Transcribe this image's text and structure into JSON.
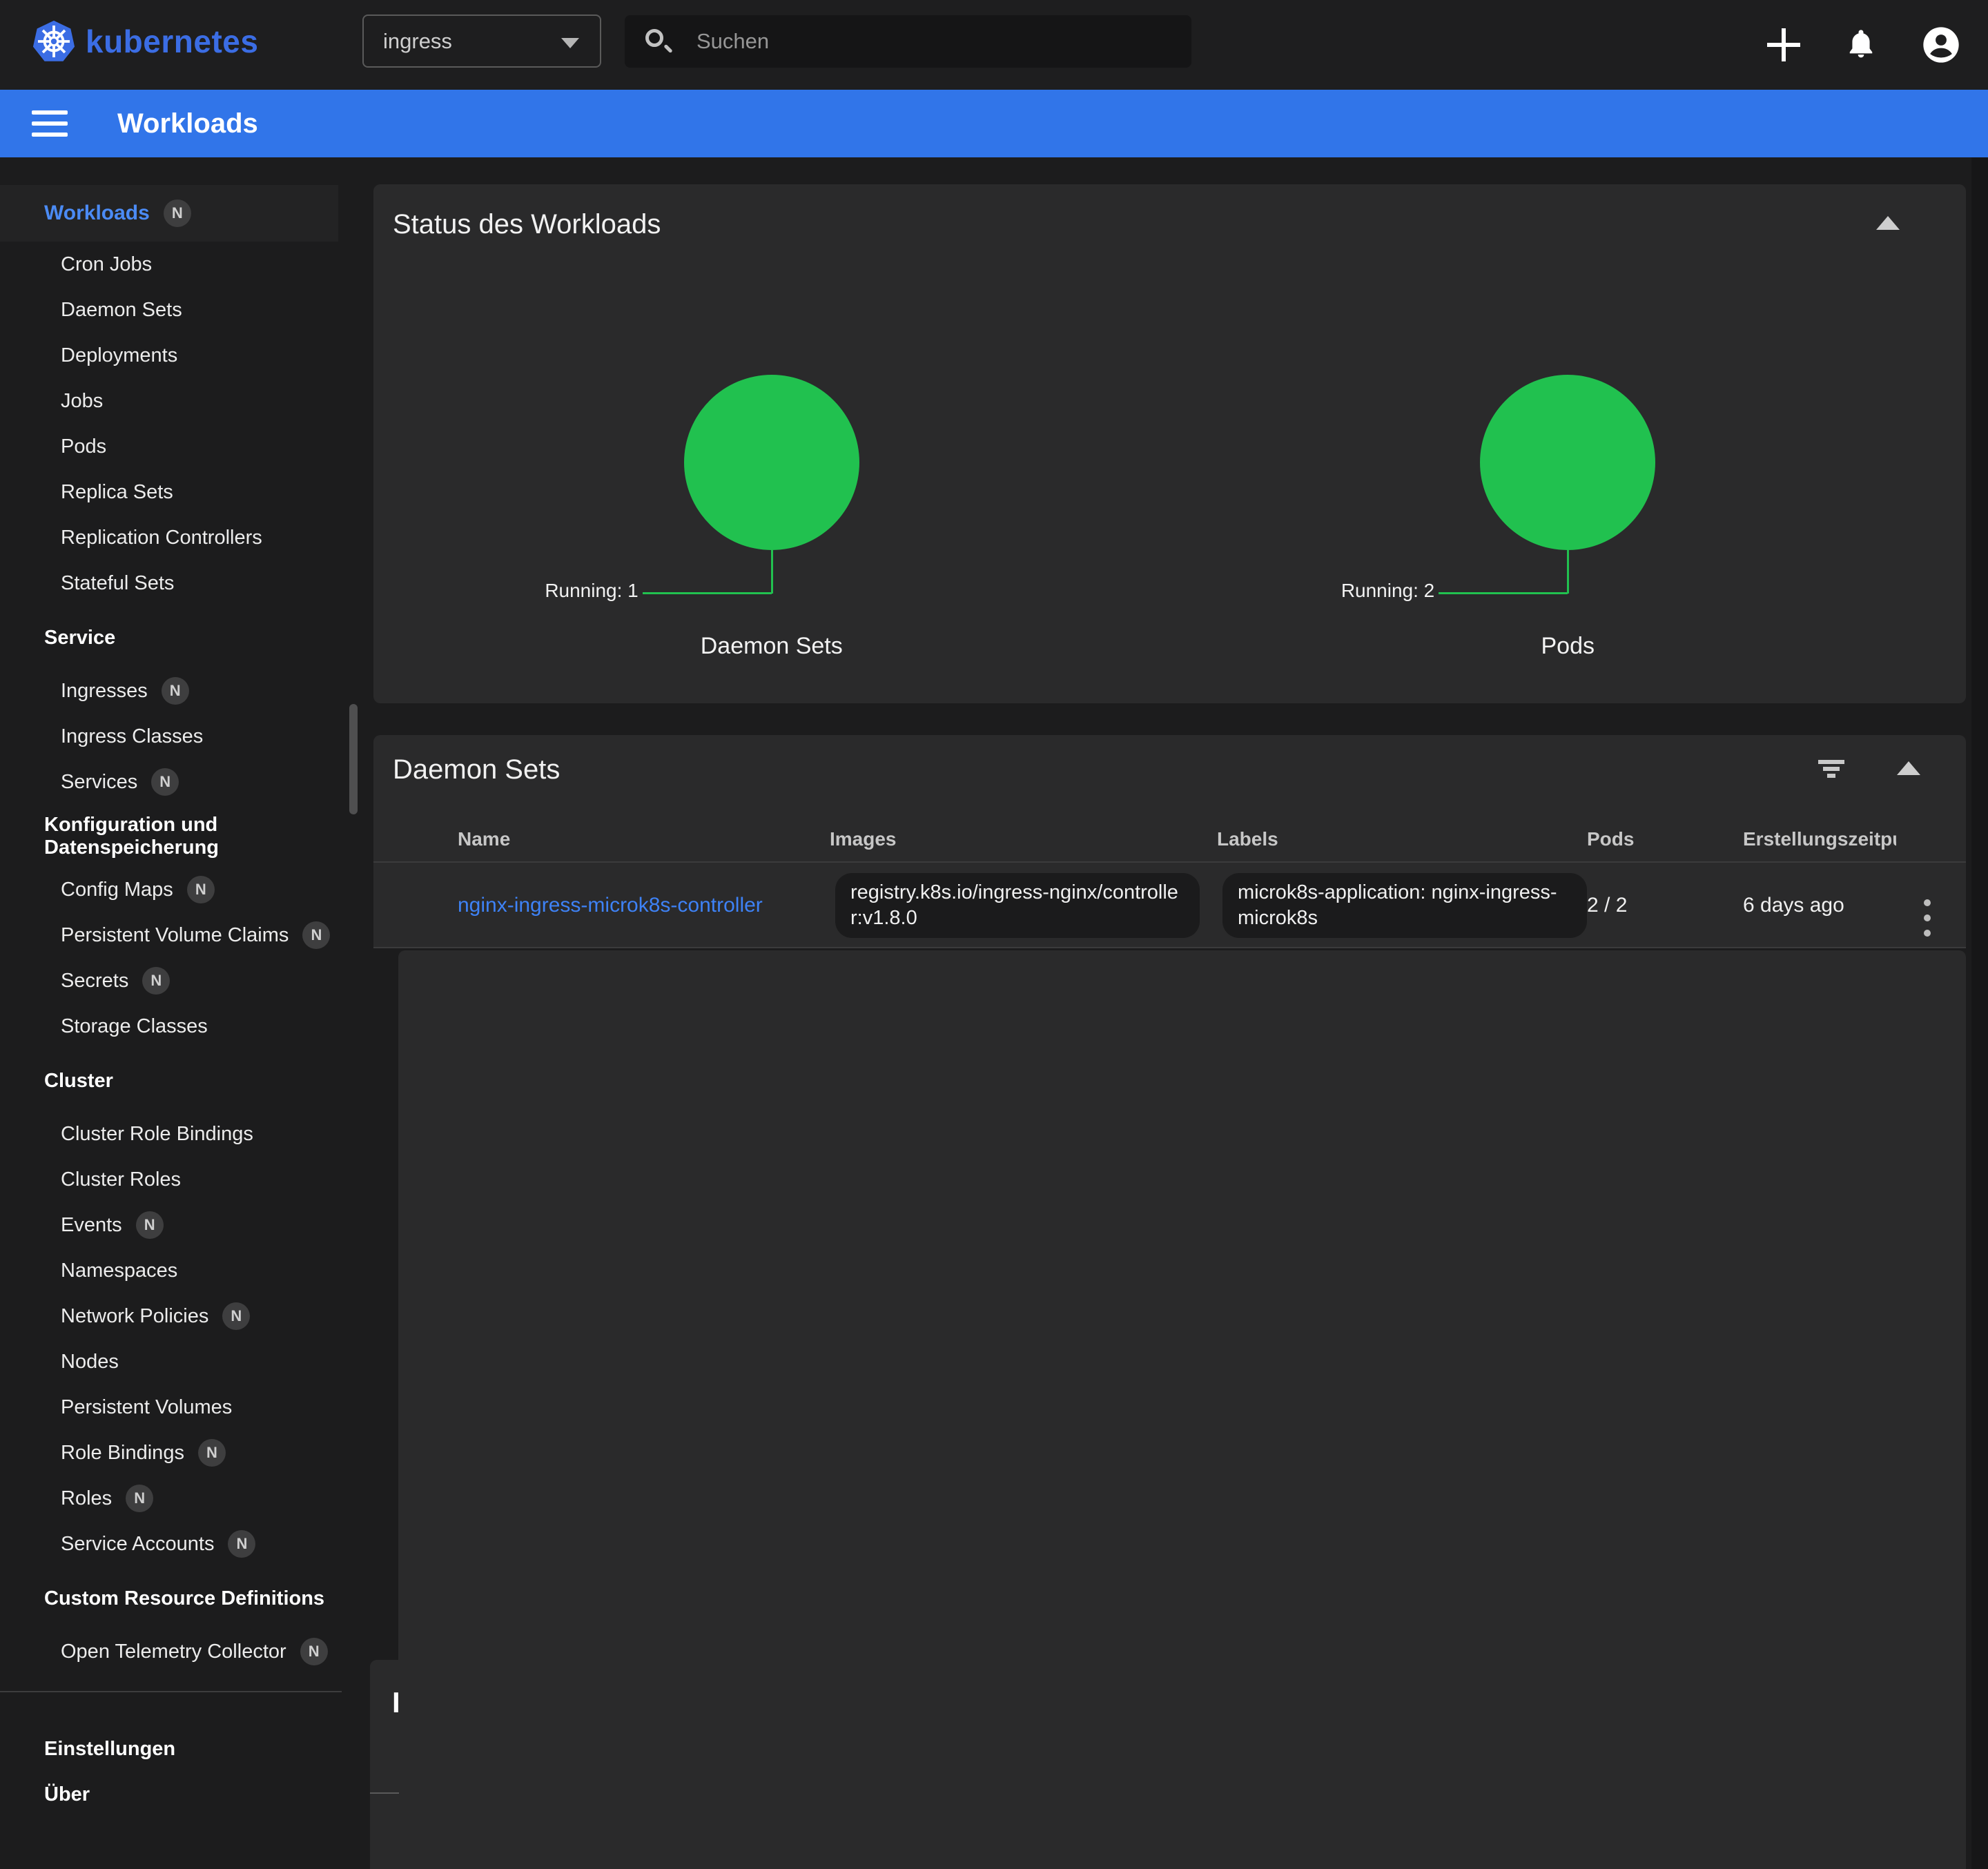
{
  "topbar": {
    "logo_text": "kubernetes",
    "namespace_selector": {
      "value": "ingress"
    },
    "search": {
      "placeholder": "Suchen"
    }
  },
  "appbar": {
    "title": "Workloads"
  },
  "sidebar": {
    "items": [
      {
        "label": "Workloads",
        "type": "active",
        "badge": "N"
      },
      {
        "label": "Cron Jobs",
        "type": "sub"
      },
      {
        "label": "Daemon Sets",
        "type": "sub"
      },
      {
        "label": "Deployments",
        "type": "sub"
      },
      {
        "label": "Jobs",
        "type": "sub"
      },
      {
        "label": "Pods",
        "type": "sub"
      },
      {
        "label": "Replica Sets",
        "type": "sub"
      },
      {
        "label": "Replication Controllers",
        "type": "sub"
      },
      {
        "label": "Stateful Sets",
        "type": "sub"
      },
      {
        "label": "Service",
        "type": "head"
      },
      {
        "label": "Ingresses",
        "type": "sub",
        "badge": "N"
      },
      {
        "label": "Ingress Classes",
        "type": "sub"
      },
      {
        "label": "Services",
        "type": "sub",
        "badge": "N"
      },
      {
        "label": "Konfiguration und Datenspeicherung",
        "type": "head"
      },
      {
        "label": "Config Maps",
        "type": "sub",
        "badge": "N"
      },
      {
        "label": "Persistent Volume Claims",
        "type": "sub",
        "badge": "N"
      },
      {
        "label": "Secrets",
        "type": "sub",
        "badge": "N"
      },
      {
        "label": "Storage Classes",
        "type": "sub"
      },
      {
        "label": "Cluster",
        "type": "head"
      },
      {
        "label": "Cluster Role Bindings",
        "type": "sub"
      },
      {
        "label": "Cluster Roles",
        "type": "sub"
      },
      {
        "label": "Events",
        "type": "sub",
        "badge": "N"
      },
      {
        "label": "Namespaces",
        "type": "sub"
      },
      {
        "label": "Network Policies",
        "type": "sub",
        "badge": "N"
      },
      {
        "label": "Nodes",
        "type": "sub"
      },
      {
        "label": "Persistent Volumes",
        "type": "sub"
      },
      {
        "label": "Role Bindings",
        "type": "sub",
        "badge": "N"
      },
      {
        "label": "Roles",
        "type": "sub",
        "badge": "N"
      },
      {
        "label": "Service Accounts",
        "type": "sub",
        "badge": "N"
      },
      {
        "label": "Custom Resource Definitions",
        "type": "head"
      },
      {
        "label": "Open Telemetry Collector",
        "type": "sub",
        "badge": "N"
      },
      {
        "type": "divider"
      },
      {
        "label": "Einstellungen",
        "type": "bottom"
      },
      {
        "label": "Über",
        "type": "bottom"
      }
    ]
  },
  "status_card": {
    "title": "Status des Workloads",
    "chart_data": {
      "type": "pie",
      "charts": [
        {
          "caption": "Daemon Sets",
          "callout": "Running: 1",
          "slices": [
            {
              "label": "Running",
              "value": 1,
              "color": "#21c14f"
            }
          ]
        },
        {
          "caption": "Pods",
          "callout": "Running: 2",
          "slices": [
            {
              "label": "Running",
              "value": 2,
              "color": "#21c14f"
            }
          ]
        }
      ]
    }
  },
  "daemonsets_card": {
    "title": "Daemon Sets",
    "table": {
      "headers": [
        "Name",
        "Images",
        "Labels",
        "Pods",
        "Erstellungszeitpunkt"
      ],
      "rows": [
        {
          "status": "running",
          "status_color": "#1f940a",
          "name": "nginx-ingress-microk8s-controller",
          "images": "registry.k8s.io/ingress-nginx/controller:v1.8.0",
          "labels": "microk8s-application: nginx-ingress-microk8s",
          "pods": "2 / 2",
          "created": "6 days ago"
        }
      ]
    }
  },
  "partial_card": {
    "visible_title_fragment": "I"
  },
  "colors": {
    "appbar_blue": "#3175e9",
    "brand_blue": "#3b6de4",
    "link_blue": "#3e82f6",
    "chart_green": "#21c14f",
    "status_green": "#1f940a",
    "card_bg": "#2a2a2b",
    "page_bg": "#1c1c1d"
  }
}
